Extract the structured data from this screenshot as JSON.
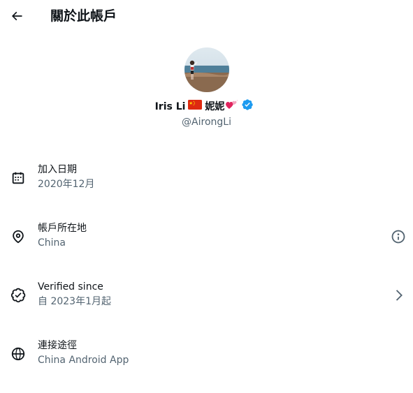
{
  "header": {
    "title": "關於此帳戶",
    "back_icon": "arrow-left-icon"
  },
  "profile": {
    "name": "Iris Li",
    "name_suffix": "妮妮",
    "flag_icon": "china-flag-icon",
    "hearts_icon": "sparkling-hearts-icon",
    "verified_icon": "verified-badge-icon",
    "verified_color": "#1d9bf0",
    "handle": "@AirongLi"
  },
  "rows": [
    {
      "icon": "calendar-icon",
      "label": "加入日期",
      "value": "2020年12月"
    },
    {
      "icon": "location-pin-icon",
      "label": "帳戶所在地",
      "value": "China",
      "trailing_icon": "info-icon"
    },
    {
      "icon": "verified-check-icon",
      "label": "Verified since",
      "value": "自 2023年1月起",
      "trailing_icon": "chevron-right-icon"
    },
    {
      "icon": "globe-icon",
      "label": "連接途徑",
      "value": "China Android App"
    }
  ],
  "colors": {
    "text": "#0f1419",
    "secondary": "#536471",
    "accent": "#1d9bf0"
  }
}
